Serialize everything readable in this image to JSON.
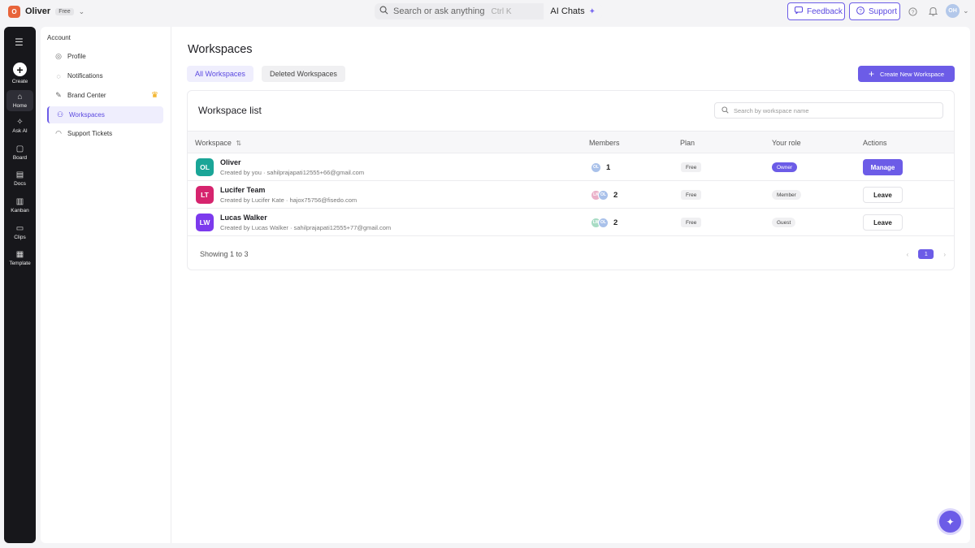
{
  "topbar": {
    "workspace_initial": "O",
    "workspace_name": "Oliver",
    "plan_badge": "Free",
    "search_placeholder": "Search or ask anything",
    "search_shortcut": "Ctrl K",
    "ai_chats_label": "AI Chats",
    "feedback_label": "Feedback",
    "support_label": "Support",
    "user_initials": "OH"
  },
  "rail": {
    "items": [
      {
        "label": "Create"
      },
      {
        "label": "Home"
      },
      {
        "label": "Ask AI"
      },
      {
        "label": "Board"
      },
      {
        "label": "Docs"
      },
      {
        "label": "Kanban"
      },
      {
        "label": "Clips"
      },
      {
        "label": "Template"
      }
    ]
  },
  "settings": {
    "heading": "Account",
    "items": [
      {
        "label": "Profile",
        "icon": "user-circle-icon"
      },
      {
        "label": "Notifications",
        "icon": "bell-icon"
      },
      {
        "label": "Brand Center",
        "icon": "brand-icon"
      },
      {
        "label": "Workspaces",
        "icon": "users-icon"
      },
      {
        "label": "Support Tickets",
        "icon": "headset-icon"
      }
    ]
  },
  "main": {
    "title": "Workspaces",
    "tabs": [
      {
        "label": "All Workspaces"
      },
      {
        "label": "Deleted Workspaces"
      }
    ],
    "create_label": "Create New Workspace",
    "card_title": "Workspace list",
    "search_placeholder": "Search by workspace name",
    "columns": [
      "Workspace",
      "Members",
      "Plan",
      "Your role",
      "Actions"
    ],
    "rows": [
      {
        "initials": "OL",
        "color": "#1aa597",
        "name": "Oliver",
        "sub": "Created by you · sahilprajapati12555+66@gmail.com",
        "member_initials": [
          "OL"
        ],
        "member_colors": [
          "#a9c1ea"
        ],
        "members": "1",
        "plan": "Free",
        "role": "Owner",
        "action": "Manage"
      },
      {
        "initials": "LT",
        "color": "#d6246e",
        "name": "Lucifer Team",
        "sub": "Created by Lucifer Kate · hajox75756@fisedo.com",
        "member_initials": [
          "LK",
          "OL"
        ],
        "member_colors": [
          "#eab0c8",
          "#a9c1ea"
        ],
        "members": "2",
        "plan": "Free",
        "role": "Member",
        "action": "Leave"
      },
      {
        "initials": "LW",
        "color": "#7c3aed",
        "name": "Lucas Walker",
        "sub": "Created by Lucas Walker · sahilprajapati12555+77@gmail.com",
        "member_initials": [
          "LW",
          "OL"
        ],
        "member_colors": [
          "#a8dcc4",
          "#a9c1ea"
        ],
        "members": "2",
        "plan": "Free",
        "role": "Guest",
        "action": "Leave"
      }
    ],
    "showing": "Showing 1 to 3",
    "page": "1"
  },
  "colors": {
    "accent": "#6c5ce7",
    "rail": "#17171b"
  }
}
